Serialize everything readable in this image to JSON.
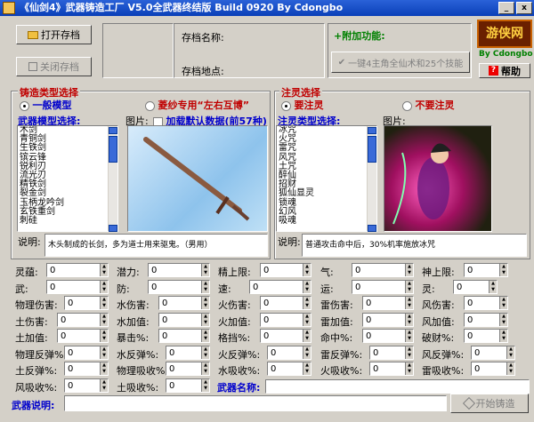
{
  "window": {
    "title": "《仙剑4》武器铸造工厂 V5.0全武器终结版 Build 0920 By Cdongbo",
    "minimize": "_",
    "close": "x"
  },
  "toolbar": {
    "open_save": "打开存档",
    "close_save": "关闭存档",
    "save_name_label": "存档名称:",
    "save_location_label": "存档地点:"
  },
  "extra": {
    "title": "+附加功能:",
    "button": "一键4主角全仙术和25个技能"
  },
  "logo": {
    "text": "游侠网",
    "credit": "By Cdongbo",
    "help": "帮助"
  },
  "forge": {
    "title": "铸造类型选择",
    "opt1": "一般模型",
    "opt2": "菱纱专用“左右互博”",
    "list_label": "武器模型选择:",
    "items": [
      "木剑",
      "青铜剑",
      "生铁剑",
      "镔云锋",
      "锐利刃",
      "流光刃",
      "精铁剑",
      "裂金剑",
      "玉柄龙吟剑",
      "玄铁重剑",
      "刺硅"
    ],
    "pic_label": "图片:",
    "load_default": "加载默认数据(前57种)",
    "desc_label": "说明:",
    "desc": "木头制成的长剑，多为道士用来驱鬼。（男用）"
  },
  "soul": {
    "title": "注灵选择",
    "opt1": "要注灵",
    "opt2": "不要注灵",
    "list_label": "注灵类型选择:",
    "items": [
      "冰咒",
      "火咒",
      "雷咒",
      "风咒",
      "土咒",
      "醉仙",
      "招财",
      "狐仙显灵",
      "锁魂",
      "幻风",
      "吸魂"
    ],
    "pic_label": "图片:",
    "desc_label": "说明:",
    "desc": "普通攻击命中后，30%机率施放冰咒"
  },
  "stats": {
    "r1": [
      "灵蕴:",
      "潜力:",
      "精上限:",
      "气:",
      "神上限:"
    ],
    "r2": [
      "武:",
      "防:",
      "速:",
      "运:",
      "灵:"
    ],
    "r3": [
      "物理伤害:",
      "水伤害:",
      "火伤害:",
      "雷伤害:",
      "风伤害:"
    ],
    "r4": [
      "土伤害:",
      "水加值:",
      "火加值:",
      "雷加值:",
      "风加值:"
    ],
    "r5": [
      "土加值:",
      "暴击%:",
      "格挡%:",
      "命中%:",
      "破财%:"
    ],
    "r6": [
      "物理反弹%:",
      "水反弹%:",
      "火反弹%:",
      "雷反弹%:",
      "风反弹%:"
    ],
    "r7": [
      "土反弹%:",
      "物理吸收%:",
      "水吸收%:",
      "火吸收%:",
      "雷吸收%:"
    ],
    "r8": [
      "风吸收%:",
      "土吸收%:"
    ],
    "spin_value": "0",
    "weapon_name_label": "武器名称:",
    "weapon_desc_label": "武器说明:",
    "start_button": "开始铸造"
  }
}
